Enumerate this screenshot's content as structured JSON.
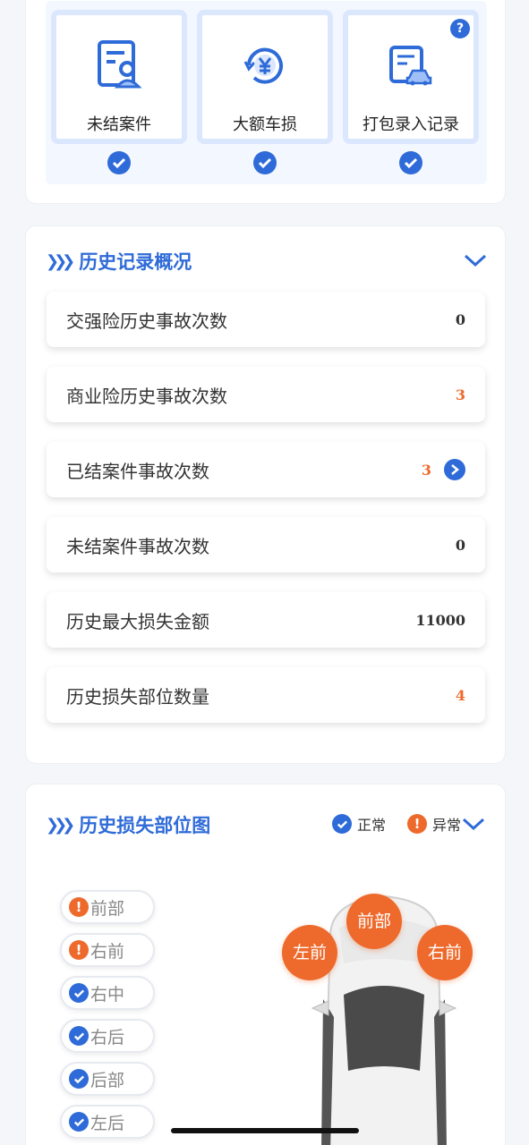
{
  "quick_entries": [
    {
      "label": "未结案件",
      "icon": "document-user-icon",
      "help": ""
    },
    {
      "label": "大额车损",
      "icon": "yen-refresh-icon",
      "help": ""
    },
    {
      "label": "打包录入记录",
      "icon": "car-document-icon",
      "help": "?"
    }
  ],
  "history": {
    "title": "历史记录概况",
    "rows": [
      {
        "label": "交强险历史事故次数",
        "value": "0",
        "alert": false,
        "link": false
      },
      {
        "label": "商业险历史事故次数",
        "value": "3",
        "alert": true,
        "link": false
      },
      {
        "label": "已结案件事故次数",
        "value": "3",
        "alert": true,
        "link": true
      },
      {
        "label": "未结案件事故次数",
        "value": "0",
        "alert": false,
        "link": false
      },
      {
        "label": "历史最大损失金额",
        "value": "11000",
        "alert": false,
        "link": false
      },
      {
        "label": "历史损失部位数量",
        "value": "4",
        "alert": true,
        "link": false
      }
    ]
  },
  "damage_map": {
    "title": "历史损失部位图",
    "legend_normal": "正常",
    "legend_abnormal": "异常",
    "parts": [
      {
        "label": "前部",
        "status": "abnormal"
      },
      {
        "label": "右前",
        "status": "abnormal"
      },
      {
        "label": "右中",
        "status": "normal"
      },
      {
        "label": "右后",
        "status": "normal"
      },
      {
        "label": "后部",
        "status": "normal"
      },
      {
        "label": "左后",
        "status": "normal"
      }
    ],
    "car_markers": [
      "左前",
      "前部",
      "右前"
    ],
    "colors": {
      "normal": "#2f6bd8",
      "abnormal": "#ee6a2c"
    }
  },
  "badge_icons": {
    "abnormal": "!",
    "help": "?"
  }
}
